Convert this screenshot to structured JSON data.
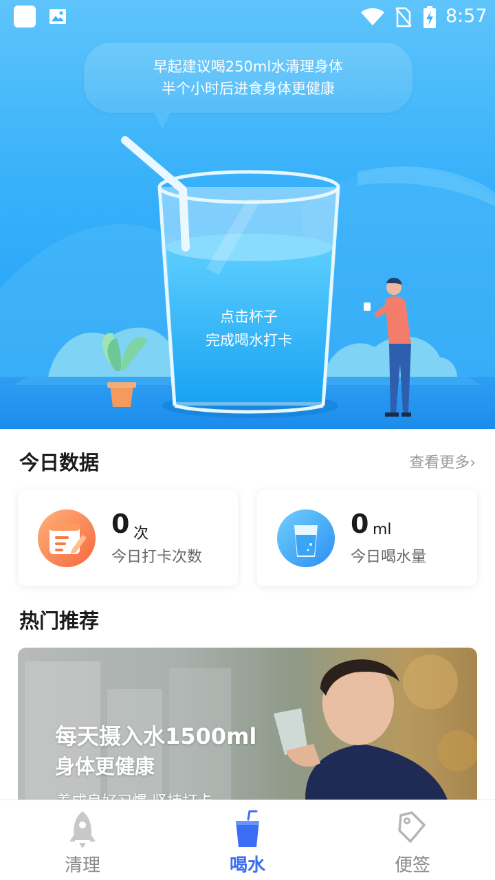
{
  "status_bar": {
    "time": "8:57"
  },
  "hero": {
    "bubble_line1": "早起建议喝250ml水清理身体",
    "bubble_line2": "半个小时后进食身体更健康",
    "cup_line1": "点击杯子",
    "cup_line2": "完成喝水打卡"
  },
  "today": {
    "title": "今日数据",
    "more": "查看更多›",
    "checkin": {
      "value": "0",
      "unit": "次",
      "label": "今日打卡次数"
    },
    "water": {
      "value": "0",
      "unit": "ml",
      "label": "今日喝水量"
    }
  },
  "recommend": {
    "title": "热门推荐",
    "banner_title": "每天摄入水1500ml",
    "banner_sub": "身体更健康",
    "banner_sub2": "养成良好习惯 坚持打卡"
  },
  "nav": {
    "items": [
      {
        "label": "清理",
        "icon": "rocket-icon",
        "active": false
      },
      {
        "label": "喝水",
        "icon": "cup-icon",
        "active": true
      },
      {
        "label": "便签",
        "icon": "tag-icon",
        "active": false
      }
    ]
  },
  "colors": {
    "accent": "#3b6ef5",
    "sky": "#3ab2fa",
    "muted": "#9a9a9a"
  }
}
